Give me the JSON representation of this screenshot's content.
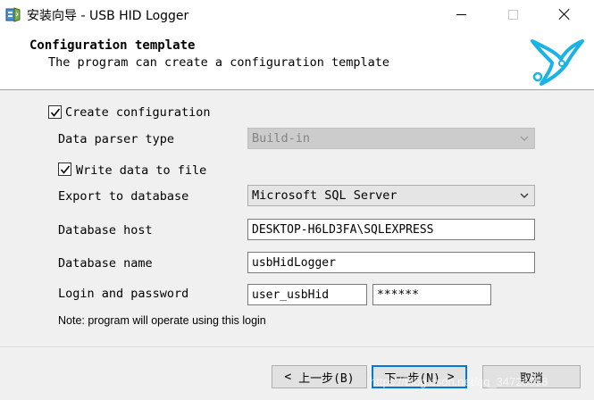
{
  "window": {
    "title": "安装向导 - USB HID Logger"
  },
  "header": {
    "title": "Configuration template",
    "subtitle": "The program can create a configuration template"
  },
  "form": {
    "create_configuration": {
      "label": "Create configuration",
      "checked": true
    },
    "data_parser_type": {
      "label": "Data parser type",
      "value": "Build-in",
      "disabled": true
    },
    "write_data_to_file": {
      "label": "Write data to file",
      "checked": true
    },
    "export_to_database": {
      "label": "Export to database",
      "value": "Microsoft SQL Server"
    },
    "database_host": {
      "label": "Database host",
      "value": "DESKTOP-H6LD3FA\\SQLEXPRESS"
    },
    "database_name": {
      "label": "Database name",
      "value": "usbHidLogger"
    },
    "login": {
      "label": "Login and password",
      "value": "user_usbHid",
      "password_masked": "******"
    },
    "note": "Note: program will operate using this login"
  },
  "buttons": {
    "back": "上一步(B)",
    "next": "下一步(N)",
    "cancel": "取消"
  },
  "watermark": "https://blog.csdn.net/qq_34726058",
  "colors": {
    "accent": "#0078d7",
    "logo": "#1ab3e6"
  }
}
